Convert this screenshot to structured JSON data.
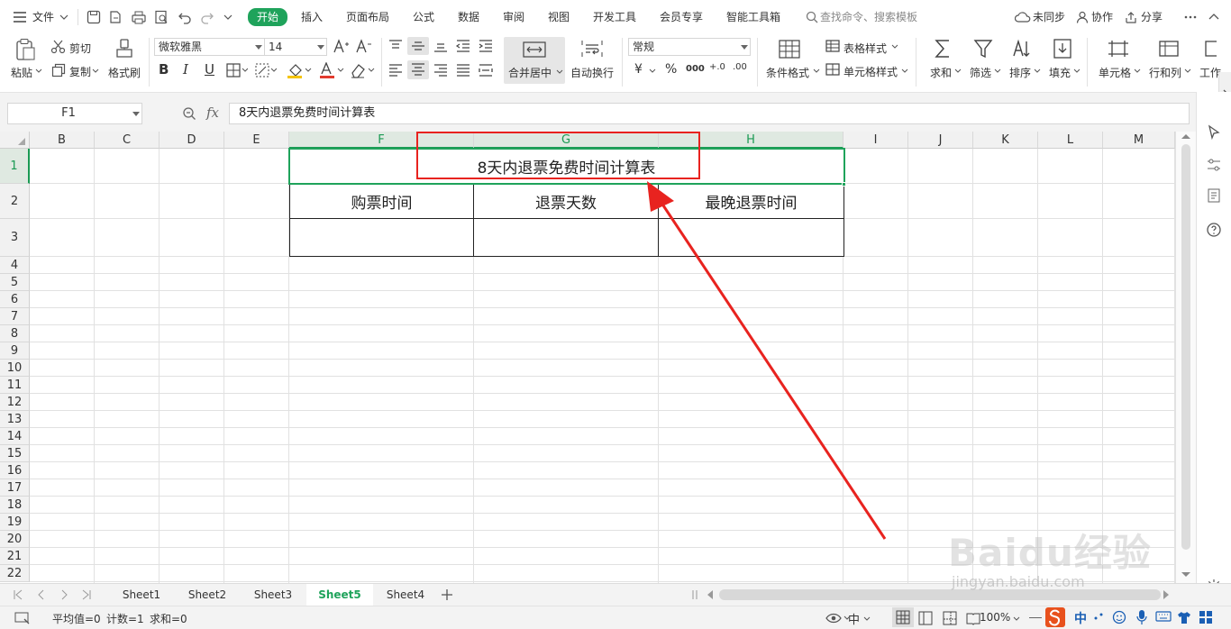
{
  "menubar": {
    "file": "文件",
    "tabs": [
      "开始",
      "插入",
      "页面布局",
      "公式",
      "数据",
      "审阅",
      "视图",
      "开发工具",
      "会员专享",
      "智能工具箱"
    ],
    "active_tab": "开始",
    "search_placeholder": "查找命令、搜索模板",
    "unsynced": "未同步",
    "collaborate": "协作",
    "share": "分享"
  },
  "ribbon": {
    "paste": "粘贴",
    "cut": "剪切",
    "copy": "复制",
    "format_painter": "格式刷",
    "font_name": "微软雅黑",
    "font_size": "14",
    "bold": "B",
    "italic": "I",
    "underline": "U",
    "merge_center": "合并居中",
    "wrap_text": "自动换行",
    "number_format": "常规",
    "currency": "¥",
    "percent": "%",
    "thousands": "000",
    "inc_decimal": "+.0",
    "dec_decimal": ".00",
    "conditional_format": "条件格式",
    "table_style": "表格样式",
    "cell_style": "单元格样式",
    "sum": "求和",
    "filter": "筛选",
    "sort": "排序",
    "fill": "填充",
    "cell": "单元格",
    "row_col": "行和列",
    "worksheet": "工作"
  },
  "formula_bar": {
    "name_box": "F1",
    "fx": "fx",
    "content": "8天内退票免费时间计算表"
  },
  "grid": {
    "columns": [
      "B",
      "C",
      "D",
      "E",
      "F",
      "G",
      "H",
      "I",
      "J",
      "K",
      "L",
      "M"
    ],
    "rows": [
      "1",
      "2",
      "3",
      "4",
      "5",
      "6",
      "7",
      "8",
      "9",
      "10",
      "11",
      "12",
      "13",
      "14",
      "15",
      "16",
      "17",
      "18",
      "19",
      "20",
      "21",
      "22"
    ],
    "title": "8天内退票免费时间计算表",
    "headers": [
      "购票时间",
      "退票天数",
      "最晚退票时间"
    ]
  },
  "sheets": {
    "tabs": [
      "Sheet1",
      "Sheet2",
      "Sheet3",
      "Sheet5",
      "Sheet4"
    ],
    "active": "Sheet5"
  },
  "status": {
    "average": "平均值=0",
    "count": "计数=1",
    "sum": "求和=0",
    "zoom": "100%",
    "ime_lang": "中",
    "ime_mode": "中"
  },
  "watermark": {
    "brand": "Baidu经验",
    "url": "jingyan.baidu.com"
  },
  "colors": {
    "accent": "#1fa35b",
    "annotation": "#e8231f"
  }
}
